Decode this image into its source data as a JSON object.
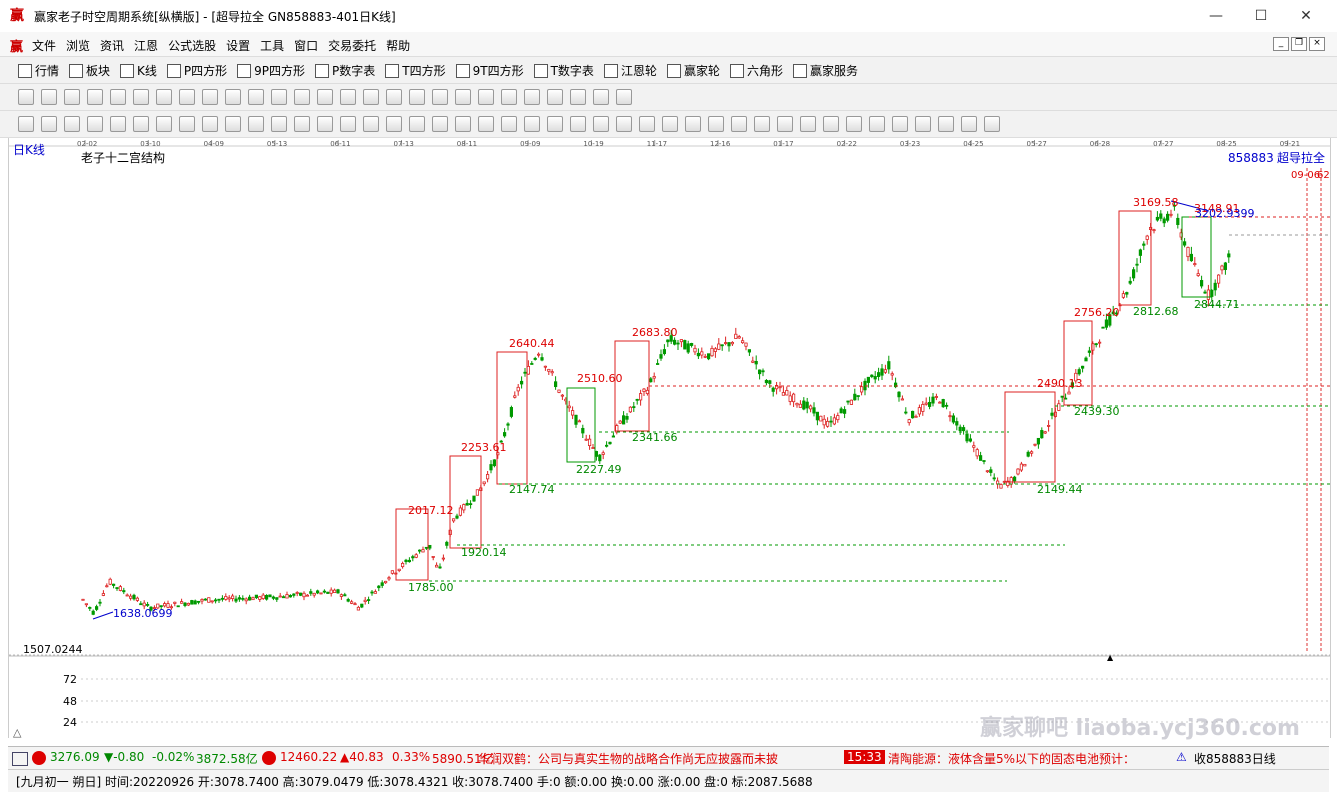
{
  "window": {
    "title": "赢家老子时空周期系统[纵横版] - [超导拉全  GN858883-401日K线]"
  },
  "menu": [
    "文件",
    "浏览",
    "资讯",
    "江恩",
    "公式选股",
    "设置",
    "工具",
    "窗口",
    "交易委托",
    "帮助"
  ],
  "toolbar1": [
    {
      "icon": "grid-icon",
      "label": "行情"
    },
    {
      "icon": "blocks-icon",
      "label": "板块"
    },
    {
      "icon": "kline-icon",
      "label": "K线"
    },
    {
      "icon": "ps-icon",
      "label": "P四方形"
    },
    {
      "icon": "p9-icon",
      "label": "9P四方形"
    },
    {
      "icon": "pn-icon",
      "label": "P数字表"
    },
    {
      "icon": "ts-icon",
      "label": "T四方形"
    },
    {
      "icon": "t9-icon",
      "label": "9T四方形"
    },
    {
      "icon": "tn-icon",
      "label": "T数字表"
    },
    {
      "icon": "gann-wheel-icon",
      "label": "江恩轮"
    },
    {
      "icon": "winner-wheel-icon",
      "label": "赢家轮"
    },
    {
      "icon": "hexagon-icon",
      "label": "六角形"
    },
    {
      "icon": "dollar-icon",
      "label": "赢家服务"
    }
  ],
  "chart": {
    "period_label": "日K线",
    "indicator_title": "老子十二宫结构",
    "code_label": "858883",
    "name_label": "超导拉全",
    "corner_date": "09-06",
    "corner_date2": "62",
    "low_price_label": "1507.0244",
    "date_ticks": [
      "02-02",
      "03-10",
      "04-09",
      "05-13",
      "06-11",
      "07-13",
      "08-11",
      "09-09",
      "10-19",
      "11-17",
      "12-16",
      "01-17",
      "02-22",
      "03-23",
      "04-25",
      "05-27",
      "06-28",
      "07-27",
      "08-25",
      "09-21"
    ],
    "sub_ticks": [
      "72",
      "48",
      "24"
    ],
    "price_labels": [
      {
        "t": "1638.0699",
        "c": "blue"
      },
      {
        "t": "2017.12",
        "c": "red"
      },
      {
        "t": "1785.00",
        "c": "green"
      },
      {
        "t": "1920.14",
        "c": "green"
      },
      {
        "t": "2253.61",
        "c": "red"
      },
      {
        "t": "2147.74",
        "c": "green"
      },
      {
        "t": "2640.44",
        "c": "red"
      },
      {
        "t": "2227.49",
        "c": "green"
      },
      {
        "t": "2510.60",
        "c": "red"
      },
      {
        "t": "2341.66",
        "c": "green"
      },
      {
        "t": "2683.80",
        "c": "red"
      },
      {
        "t": "2490.13",
        "c": "red"
      },
      {
        "t": "2149.44",
        "c": "green"
      },
      {
        "t": "2439.30",
        "c": "green"
      },
      {
        "t": "2756.20",
        "c": "red"
      },
      {
        "t": "2812.68",
        "c": "green"
      },
      {
        "t": "3169.58",
        "c": "red"
      },
      {
        "t": "3148.91",
        "c": "red"
      },
      {
        "t": "3202.9399",
        "c": "blue"
      },
      {
        "t": "2844.71",
        "c": "green"
      }
    ]
  },
  "status": {
    "idx1_value": "3276.09",
    "idx1_change": "▼-0.80",
    "idx1_pct": "-0.02%",
    "idx1_amount": "3872.58亿",
    "idx2_value": "12460.22",
    "idx2_change": "▲40.83",
    "idx2_pct": "0.33%",
    "idx2_amount": "5890.51亿",
    "news1": "华润双鹤：公司与真实生物的战略合作尚无应披露而未披",
    "news_time": "15:33",
    "news2": "清陶能源：液体含量5%以下的固态电池预计：",
    "right_code": "收858883日线"
  },
  "infoline": "[九月初一  朔日] 时间:20220926 开:3078.7400 高:3079.0479 低:3078.4321 收:3078.7400 手:0 额:0.00 换:0.00 涨:0.00 盘:0 标:2087.5688",
  "watermark": "赢家聊吧 liaoba.ycj360.com"
}
